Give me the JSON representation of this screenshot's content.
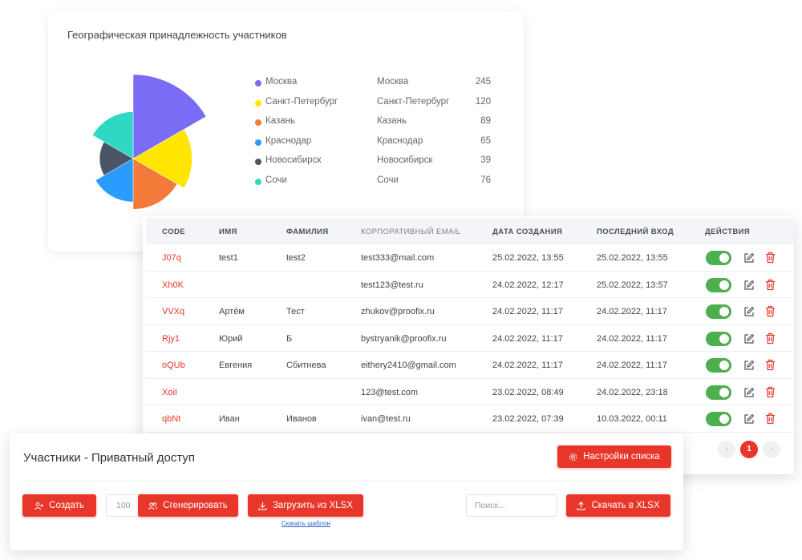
{
  "chart_data": {
    "type": "pie",
    "title": "Географическая принадлежность участников",
    "categories": [
      "Москва",
      "Санкт-Петербург",
      "Казань",
      "Краснодар",
      "Новосибирск",
      "Сочи"
    ],
    "values": [
      245,
      120,
      89,
      65,
      39,
      76
    ],
    "colors": [
      "#7b6cf6",
      "#ffe600",
      "#f47a3a",
      "#2a9cff",
      "#4a5566",
      "#2ed8c3"
    ],
    "variant": "polar-area",
    "legend_position": "right"
  },
  "chart": {
    "title": "Географическая принадлежность участников",
    "legend": [
      {
        "name": "Москва",
        "label": "Москва",
        "value": "245",
        "color": "#7b6cf6"
      },
      {
        "name": "Санкт-Петербург",
        "label": "Санкт-Петербург",
        "value": "120",
        "color": "#ffe600"
      },
      {
        "name": "Казань",
        "label": "Казань",
        "value": "89",
        "color": "#f47a3a"
      },
      {
        "name": "Краснодар",
        "label": "Краснодар",
        "value": "65",
        "color": "#2a9cff"
      },
      {
        "name": "Новосибирск",
        "label": "Новосибирск",
        "value": "39",
        "color": "#4a5566"
      },
      {
        "name": "Сочи",
        "label": "Сочи",
        "value": "76",
        "color": "#2ed8c3"
      }
    ]
  },
  "table": {
    "columns": [
      "CODE",
      "ИМЯ",
      "ФАМИЛИЯ",
      "КОРПОРАТИВНЫЙ EMAIL",
      "ДАТА СОЗДАНИЯ",
      "ПОСЛЕДНИЙ ВХОД",
      "ДЕЙСТВИЯ"
    ],
    "rows": [
      {
        "code": "J07q",
        "first": "test1",
        "last": "test2",
        "email": "test333@mail.com",
        "created": "25.02.2022, 13:55",
        "last_login": "25.02.2022, 13:55"
      },
      {
        "code": "Xh0K",
        "first": "",
        "last": "",
        "email": "test123@test.ru",
        "created": "24.02.2022, 12:17",
        "last_login": "25.02.2022, 13:57"
      },
      {
        "code": "VVXq",
        "first": "Артём",
        "last": "Тест",
        "email": "zhukov@proofix.ru",
        "created": "24.02.2022, 11:17",
        "last_login": "24.02.2022, 11:17"
      },
      {
        "code": "Rjy1",
        "first": "Юрий",
        "last": "Б",
        "email": "bystryanik@proofix.ru",
        "created": "24.02.2022, 11:17",
        "last_login": "24.02.2022, 11:17"
      },
      {
        "code": "oQUb",
        "first": "Евгения",
        "last": "Сбитнева",
        "email": "eithery2410@gmail.com",
        "created": "24.02.2022, 11:17",
        "last_login": "24.02.2022, 11:17"
      },
      {
        "code": "XoiI",
        "first": "",
        "last": "",
        "email": "123@test.com",
        "created": "23.02.2022, 08:49",
        "last_login": "24.02.2022, 23:18"
      },
      {
        "code": "qbNt",
        "first": "Иван",
        "last": "Иванов",
        "email": "ivan@test.ru",
        "created": "23.02.2022, 07:39",
        "last_login": "10.03.2022, 00:11"
      }
    ],
    "pagination": {
      "prev": "‹",
      "current": "1",
      "next": "›"
    }
  },
  "panel": {
    "title": "Участники - Приватный доступ",
    "settings_label": "Настройки списка",
    "create_label": "Создать",
    "quantity_placeholder": "100",
    "generate_label": "Сгенерировать",
    "upload_label": "Загрузить из XLSX",
    "template_link": "Скачать шаблон",
    "search_placeholder": "Поиск...",
    "download_label": "Скачать в XLSX"
  }
}
